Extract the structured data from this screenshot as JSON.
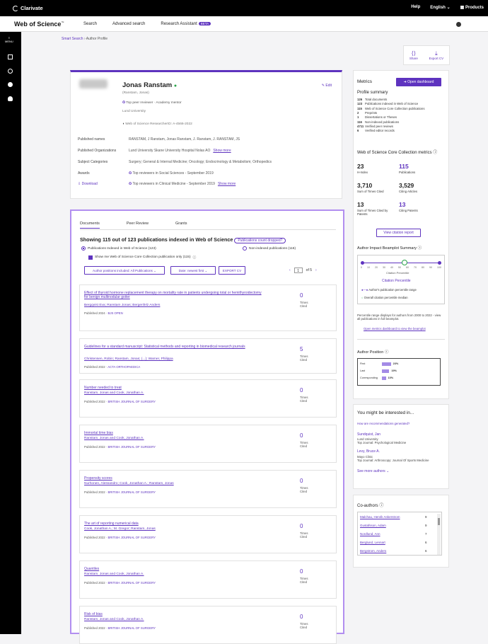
{
  "topbar": {
    "brand": "Clarivate",
    "help": "Help",
    "lang": "English ⌄",
    "products": "▦ Products"
  },
  "nav": {
    "title": "Web of Science",
    "tm": "™",
    "links": [
      "Search",
      "Advanced search",
      "Research Assistant"
    ],
    "beta": "BETA"
  },
  "sidebar": {
    "menu": "MENU"
  },
  "breadcrumb": {
    "smart": "Smart Search",
    "sep": " › ",
    "current": "Author Profile"
  },
  "tools": {
    "share": "Share",
    "export": "Export CV"
  },
  "profile": {
    "name": "Jonas Ranstam",
    "alias": "(Ranstam, Jonas)",
    "badges": "Top peer reviewer · Academy mentor",
    "org": "Lund University",
    "rid": "Web of Science ResearcherID: A-4566-2022",
    "edit": "Edit",
    "published_names_label": "Published names",
    "published_names": "RANSTAM, J    Ranstam, Jonas    Ranstam, J.    Ranstam, J.    RANSTAM, JS",
    "orgs_label": "Published Organizations",
    "orgs": "Lund University   Skane University Hospital   Nolas AO",
    "show_more": "Show more",
    "cats_label": "Subject Categories",
    "cats": "Surgery; General & Internal Medicine; Oncology; Endocrinology & Metabolism; Orthopedics",
    "awards_label": "Awards",
    "award1": "Top reviewers in Social Sciences - September 2019",
    "award2": "Top reviewers in Clinical Medicine - September 2019",
    "download": "Download"
  },
  "metrics": {
    "title": "Metrics",
    "dashboard": "Open dashboard",
    "summary_title": "Profile summary",
    "summary": [
      {
        "n": "126",
        "t": "Total documents"
      },
      {
        "n": "123",
        "t": "Publications indexed in Web of Science"
      },
      {
        "n": "115",
        "t": "Web of Science Core Collection publications"
      },
      {
        "n": "2",
        "t": "Preprints"
      },
      {
        "n": "1",
        "t": "Dissertations or Theses"
      },
      {
        "n": "116",
        "t": "Non-indexed publications"
      },
      {
        "n": "4711",
        "t": "Verified peer reviews"
      },
      {
        "n": "6",
        "t": "Verified editor records"
      }
    ],
    "core_title": "Web of Science Core Collection metrics",
    "hindex": "23",
    "hindex_label": "H-Index",
    "pubs": "115",
    "pubs_label": "Publications",
    "cited": "3,710",
    "cited_label": "Sum of Times Cited",
    "citing": "3,529",
    "citing_label": "Citing Articles",
    "patents_cited": "13",
    "patents_cited_label": "Sum of Times Cited by Patents",
    "citing_patents": "13",
    "citing_patents_label": "Citing Patents",
    "view_report": "View citation report",
    "beamplot_title": "Author Impact Beamplot Summary",
    "axis": [
      "0",
      "10",
      "20",
      "30",
      "40",
      "50",
      "60",
      "70",
      "80",
      "90",
      "100"
    ],
    "citation_pct": "Citation Percentile",
    "legend1": "Author's publication percentile range",
    "legend2": "Overall citation percentile median",
    "note": "Percentile range displays for authors from 2000 to 2022 - view all publications in full beamplot.",
    "open_dash": "Open metrics dashboard to view the beamplot",
    "position_title": "Author Position",
    "positions": [
      {
        "label": "First",
        "pct": "23%",
        "v": 23
      },
      {
        "label": "Last",
        "pct": "19%",
        "v": 19
      },
      {
        "label": "Corresponding",
        "pct": "10%",
        "v": 10
      }
    ]
  },
  "interest": {
    "title": "You might be interested in...",
    "how": "How are recommendations generated?",
    "people": [
      {
        "name": "Sundquist, Jan",
        "org": "Lund University",
        "note": "Top Journal: Psychological Medicine"
      },
      {
        "name": "Levy, Bruce A.",
        "org": "Mayo Clinic",
        "note": "Top Journal: Arthroscopy: Journal Of Sports Medicine"
      }
    ],
    "more": "See more authors ⌄"
  },
  "coauthors": {
    "title": "Co-authors",
    "list": [
      {
        "name": "Malchau, Henrik Ankerstrom",
        "n": "9"
      },
      {
        "name": "Gustafsson, Adam",
        "n": "9"
      },
      {
        "name": "Nordlund, Ann",
        "n": "7"
      },
      {
        "name": "Berglund, Lennart",
        "n": "6"
      },
      {
        "name": "Bergstrom, Anders",
        "n": "6"
      }
    ]
  },
  "docs": {
    "tabs": [
      "Documents",
      "Peer Review",
      "Grants"
    ],
    "showing": "Showing 115 out of 123 publications indexed in Web of Science",
    "pill": "Publications count dropped?",
    "radio1": "Publications Indexed in Web of Science (123)",
    "radio2": "Non-indexed publications (116)",
    "checkbox": "Show me Web of Science Core Collection publication only (115)",
    "btn1": "Author positions included: All Publications ⌄",
    "btn2": "Date: newest first ⌄",
    "btn3": "EXPORT CV",
    "page": "1",
    "of": "of 5",
    "times": "Times",
    "cited": "Cited",
    "cards": [
      {
        "title": "Effect of thyroid hormone replacement therapy on mortality rate in patients undergoing total or hemithyroidectomy for benign multinodular goiter",
        "authors": "Bergqvist Eva; Ranstam Jonas; Bergenfelz Anders",
        "pub": "Published 2024 · ",
        "journal": "BJS OPEN",
        "cites": "0"
      },
      {
        "title": "Guidelines for a standard manuscript: Statistical methods and reporting in biomedical research journals",
        "authors": "Christensen, Robin; Ranstam, Jonas; (...); Warner, Philippa",
        "pub": "Published 2022 · ",
        "journal": "ACTA ORTHOPAEDICA",
        "cites": "5"
      },
      {
        "title": "Number needed to treat",
        "authors": "Ranstam, Jonas and Cook, Jonathan A.",
        "pub": "Published 2022 · ",
        "journal": "BRITISH JOURNAL OF SURGERY",
        "cites": "0"
      },
      {
        "title": "Immortal time bias",
        "authors": "Ranstam, Jonas and Cook, Jonathan A.",
        "pub": "Published 2022 · ",
        "journal": "BRITISH JOURNAL OF SURGERY",
        "cites": "0"
      },
      {
        "title": "Propensity scores",
        "authors": "Nurhonen, Alessandro; Cook, Jonathan A.; Ranstam, Jonas",
        "pub": "Published 2022 · ",
        "journal": "BRITISH JOURNAL OF SURGERY",
        "cites": "0"
      },
      {
        "title": "The art of reporting numerical data",
        "authors": "Cook, Jonathan A.; M. Gregor; Ranstam, Jonas",
        "pub": "Published 2022 · ",
        "journal": "BRITISH JOURNAL OF SURGERY",
        "cites": "0"
      },
      {
        "title": "Quantiles",
        "authors": "Ranstam, Jonas and Cook, Jonathan A.",
        "pub": "Published 2022 · ",
        "journal": "BRITISH JOURNAL OF SURGERY",
        "cites": "0"
      },
      {
        "title": "Risk of bias",
        "authors": "Ranstam, Jonas and Cook, Jonathan A.",
        "pub": "Published 2022 · ",
        "journal": "BRITISH JOURNAL OF SURGERY",
        "cites": "0"
      }
    ]
  }
}
